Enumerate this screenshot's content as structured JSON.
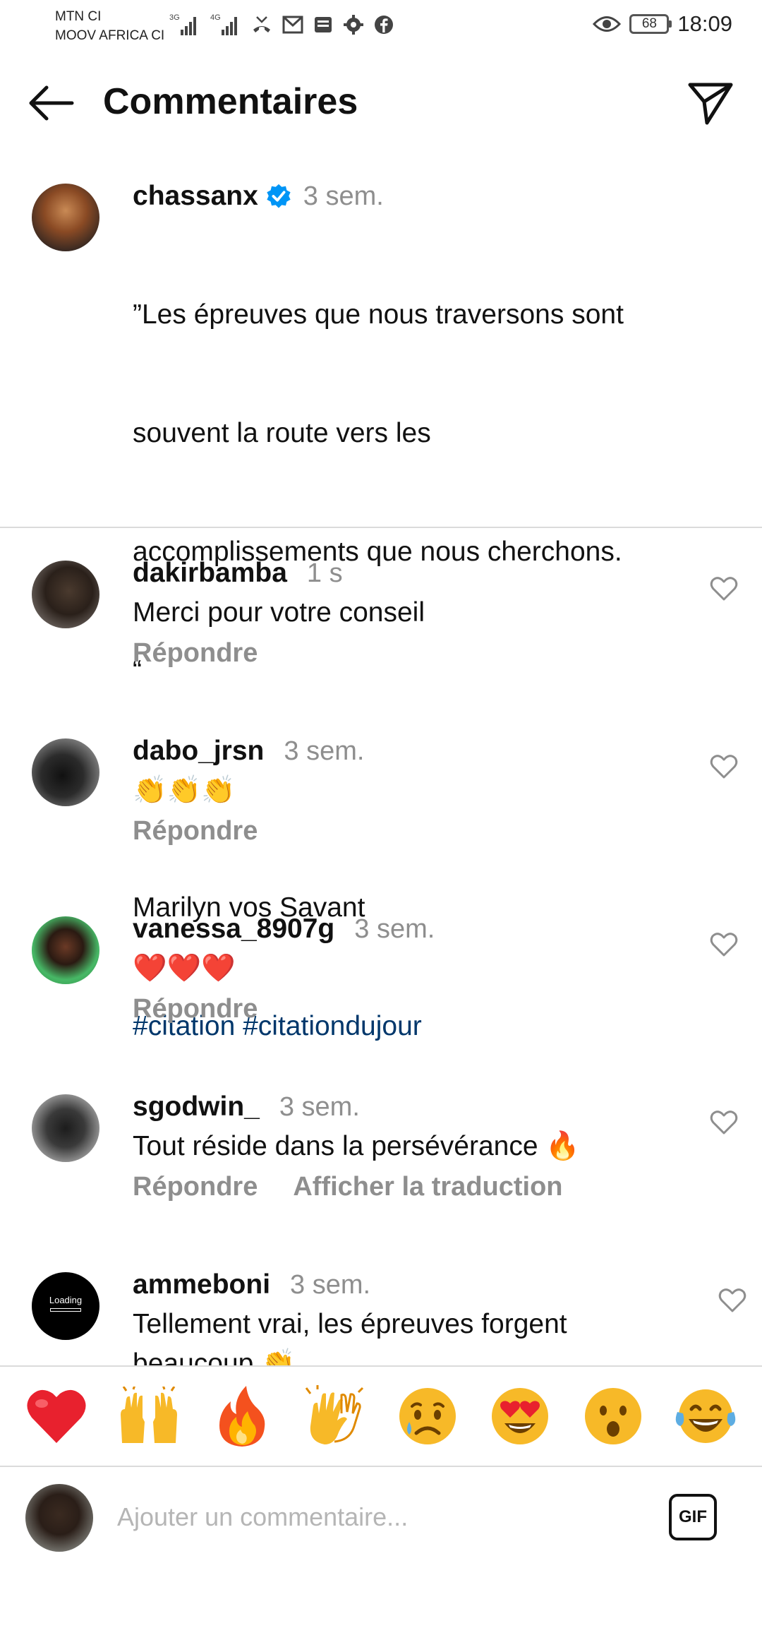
{
  "status_bar": {
    "carrier_1": "MTN CI",
    "carrier_2": "MOOV AFRICA CI",
    "network_1": "3G",
    "network_2": "4G",
    "battery": "68",
    "time": "18:09"
  },
  "header": {
    "title": "Commentaires"
  },
  "post": {
    "username": "chassanx",
    "verified": true,
    "time": "3 sem.",
    "caption_lines": [
      "”Les épreuves que nous traversons sont",
      "souvent la route vers les",
      "accomplissements que nous cherchons.",
      "“",
      "",
      "Marilyn vos Savant"
    ],
    "hashtags": [
      "#citation",
      "#citationdujour"
    ]
  },
  "comments": [
    {
      "username": "dakirbamba",
      "time": "1 s",
      "text": "Merci pour votre conseil",
      "reply_label": "Répondre"
    },
    {
      "username": "dabo_jrsn",
      "time": "3 sem.",
      "text": "👏👏👏",
      "reply_label": "Répondre"
    },
    {
      "username": "vanessa_8907g",
      "time": "3 sem.",
      "text": "❤️❤️❤️",
      "reply_label": "Répondre"
    },
    {
      "username": "sgodwin_",
      "time": "3 sem.",
      "text": "Tout réside dans la persévérance 🔥",
      "reply_label": "Répondre",
      "translate_label": "Afficher la traduction"
    },
    {
      "username": "ammeboni",
      "time": "3 sem.",
      "text": "Tellement vrai, les épreuves forgent",
      "text_2": "beaucoup 👏",
      "avatar_text": "Loading"
    }
  ],
  "reactions": [
    "❤️",
    "🙌",
    "🔥",
    "👏",
    "😢",
    "😍",
    "😮",
    "😂"
  ],
  "composer": {
    "placeholder": "Ajouter un commentaire...",
    "gif_label": "GIF"
  },
  "colors": {
    "hashtag": "#00376b",
    "secondary_text": "#8e8e8e",
    "verified_badge": "#0095f6",
    "divider": "#dbdbdb"
  },
  "icons": {
    "back": "arrow-left-icon",
    "send": "paper-plane-icon",
    "like": "heart-outline-icon",
    "verified": "verified-badge-icon"
  }
}
